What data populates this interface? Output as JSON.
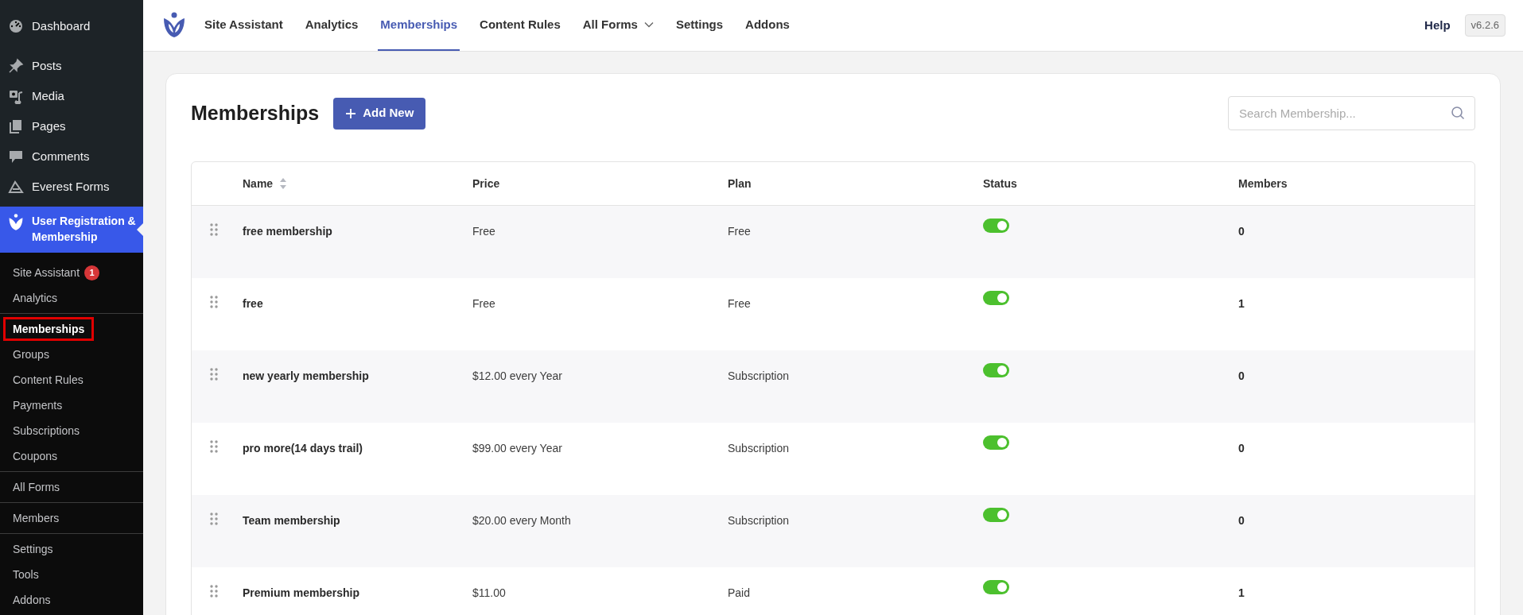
{
  "sidebar": {
    "top_items": [
      {
        "label": "Dashboard"
      },
      {
        "label": "Posts"
      },
      {
        "label": "Media"
      },
      {
        "label": "Pages"
      },
      {
        "label": "Comments"
      },
      {
        "label": "Everest Forms"
      }
    ],
    "active_menu": {
      "label": "User Registration & Membership"
    },
    "submenu_groups": [
      [
        {
          "label": "Site Assistant",
          "badge": "1",
          "selected": false,
          "highlighted": false
        },
        {
          "label": "Analytics",
          "selected": false,
          "highlighted": false
        }
      ],
      [
        {
          "label": "Memberships",
          "selected": true,
          "highlighted": true
        },
        {
          "label": "Groups",
          "selected": false,
          "highlighted": false
        },
        {
          "label": "Content Rules",
          "selected": false,
          "highlighted": false
        },
        {
          "label": "Payments",
          "selected": false,
          "highlighted": false
        },
        {
          "label": "Subscriptions",
          "selected": false,
          "highlighted": false
        },
        {
          "label": "Coupons",
          "selected": false,
          "highlighted": false
        }
      ],
      [
        {
          "label": "All Forms",
          "selected": false,
          "highlighted": false
        }
      ],
      [
        {
          "label": "Members",
          "selected": false,
          "highlighted": false
        }
      ],
      [
        {
          "label": "Settings",
          "selected": false,
          "highlighted": false
        },
        {
          "label": "Tools",
          "selected": false,
          "highlighted": false
        },
        {
          "label": "Addons",
          "selected": false,
          "highlighted": false
        }
      ]
    ]
  },
  "top_nav": {
    "tabs": [
      {
        "label": "Site Assistant",
        "selected": false,
        "dropdown": false
      },
      {
        "label": "Analytics",
        "selected": false,
        "dropdown": false
      },
      {
        "label": "Memberships",
        "selected": true,
        "dropdown": false
      },
      {
        "label": "Content Rules",
        "selected": false,
        "dropdown": false
      },
      {
        "label": "All Forms",
        "selected": false,
        "dropdown": true
      },
      {
        "label": "Settings",
        "selected": false,
        "dropdown": false
      },
      {
        "label": "Addons",
        "selected": false,
        "dropdown": false
      }
    ],
    "help": "Help",
    "version": "v6.2.6"
  },
  "page": {
    "title": "Memberships",
    "add_button": "Add New",
    "search": {
      "placeholder": "Search Membership..."
    }
  },
  "table": {
    "columns": [
      "Name",
      "Price",
      "Plan",
      "Status",
      "Members"
    ],
    "rows": [
      {
        "name": "free membership",
        "price": "Free",
        "plan": "Free",
        "status_on": true,
        "members": "0"
      },
      {
        "name": "free",
        "price": "Free",
        "plan": "Free",
        "status_on": true,
        "members": "1"
      },
      {
        "name": "new yearly membership",
        "price": "$12.00 every Year",
        "plan": "Subscription",
        "status_on": true,
        "members": "0"
      },
      {
        "name": "pro more(14 days trail)",
        "price": "$99.00 every Year",
        "plan": "Subscription",
        "status_on": true,
        "members": "0"
      },
      {
        "name": "Team membership",
        "price": "$20.00 every Month",
        "plan": "Subscription",
        "status_on": true,
        "members": "0"
      },
      {
        "name": "Premium membership",
        "price": "$11.00",
        "plan": "Paid",
        "status_on": true,
        "members": "1"
      }
    ]
  }
}
